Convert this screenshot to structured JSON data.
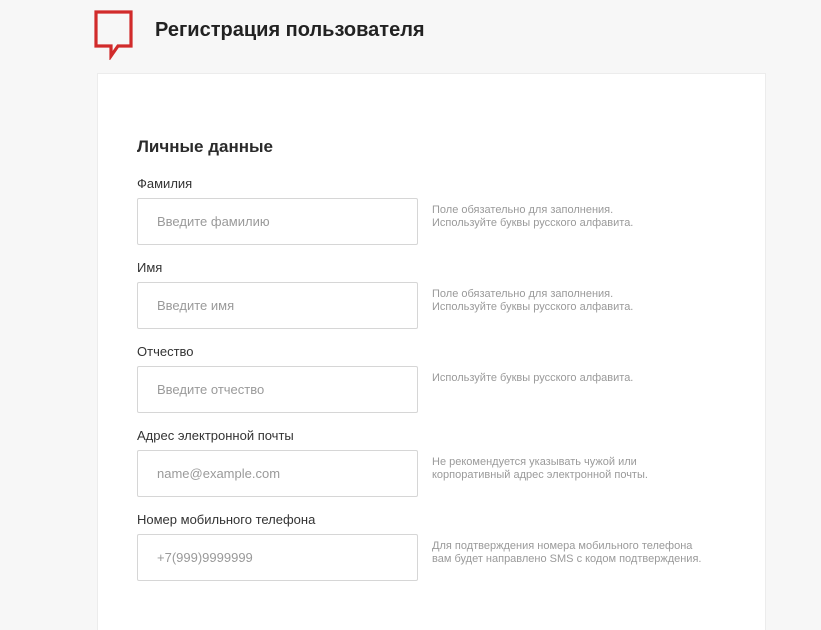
{
  "header": {
    "title": "Регистрация пользователя",
    "logo_icon": "speech-bubble-logo-icon",
    "brand_color": "#d12b2b"
  },
  "section": {
    "title": "Личные данные"
  },
  "fields": [
    {
      "label": "Фамилия",
      "placeholder": "Введите фамилию",
      "value": "",
      "hint": [
        "Поле обязательно для заполнения.",
        "Используйте буквы русского алфавита."
      ]
    },
    {
      "label": "Имя",
      "placeholder": "Введите имя",
      "value": "",
      "hint": [
        "Поле обязательно для заполнения.",
        "Используйте буквы русского алфавита."
      ]
    },
    {
      "label": "Отчество",
      "placeholder": "Введите отчество",
      "value": "",
      "hint": [
        "Используйте буквы русского алфавита."
      ]
    },
    {
      "label": "Адрес электронной почты",
      "placeholder": "name@example.com",
      "value": "",
      "hint": [
        "Не рекомендуется указывать чужой или",
        "корпоративный адрес электронной почты."
      ]
    },
    {
      "label": "Номер мобильного телефона",
      "placeholder": "+7(999)9999999",
      "value": "",
      "hint": [
        "Для подтверждения номера мобильного телефона",
        "вам будет направлено SMS с кодом подтверждения."
      ]
    }
  ]
}
